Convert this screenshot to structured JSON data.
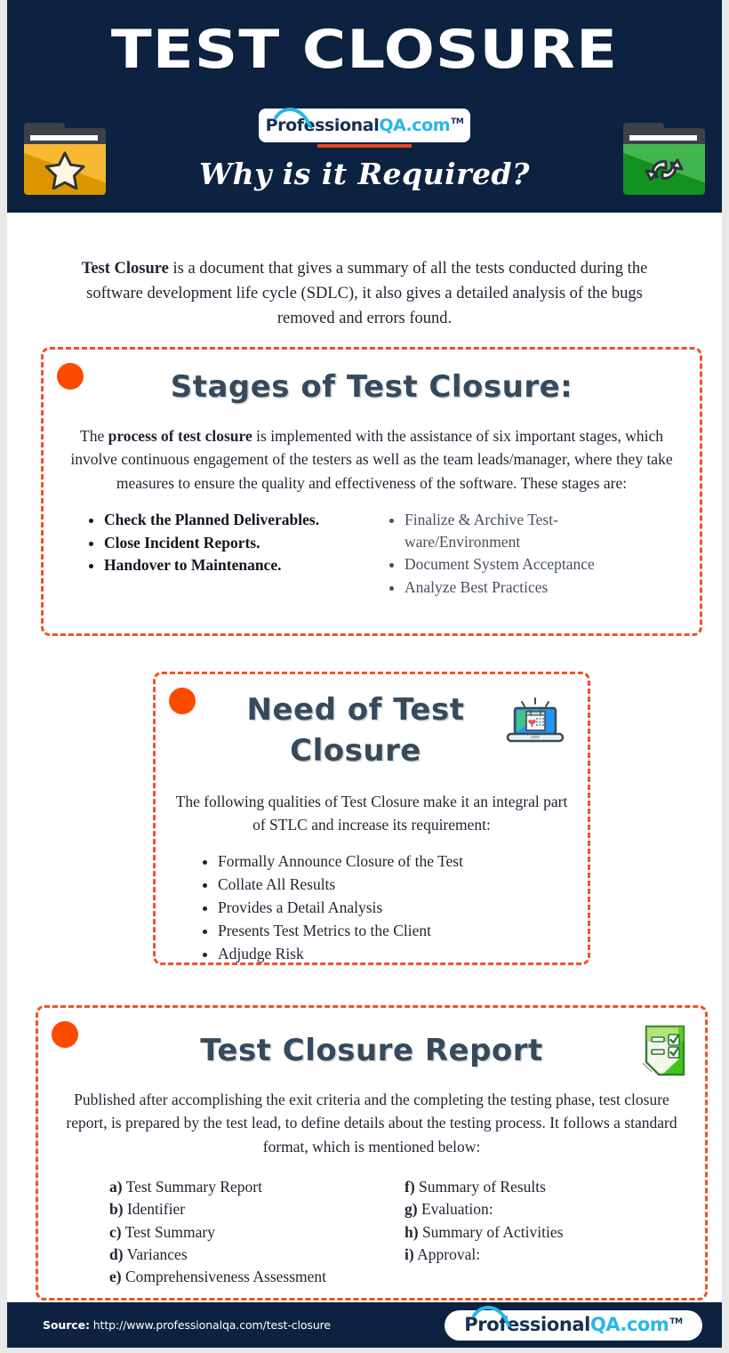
{
  "header": {
    "title": "TEST CLOSURE",
    "subtitle": "Why is it Required?",
    "logo": {
      "part1": "Professional",
      "part2": "QA",
      "part3": ".com",
      "tm": "TM"
    },
    "icons": {
      "left": "star-folder-icon",
      "right": "sync-folder-icon"
    },
    "colors": {
      "background": "#0d2240",
      "logo_dark": "#17304f",
      "logo_cyan": "#29b6e8",
      "logo_underline": "#e8491d"
    }
  },
  "intro": {
    "bold_lead": "Test Closure",
    "rest": " is a document that gives a summary of all the tests conducted during the software development life cycle (SDLC), it also gives a detailed analysis of the bugs removed and errors found."
  },
  "sections": [
    {
      "id": "stages",
      "title": "Stages of Test Closure:",
      "paragraph_parts": [
        {
          "text": "The ",
          "bold": false
        },
        {
          "text": "process of test closure",
          "bold": true
        },
        {
          "text": " is implemented with the assistance of six important stages, which involve continuous engagement of the testers as well as the team leads/manager, where they take measures to ensure the quality and effectiveness of the software. These stages are:",
          "bold": false
        }
      ],
      "list_left": [
        "Check the Planned Deliverables.",
        "Close Incident Reports.",
        "Handover to Maintenance."
      ],
      "list_right": [
        "Finalize & Archive Test-ware/Environment",
        "Document System Acceptance",
        "Analyze Best Practices"
      ]
    },
    {
      "id": "need",
      "title": "Need of Test Closure",
      "paragraph": "The following qualities of Test Closure make it an integral part of STLC and increase its requirement:",
      "icon": "laptop-calendar-icon",
      "list": [
        "Formally Announce Closure of the Test",
        "Collate All Results",
        "Provides a Detail Analysis",
        "Presents Test Metrics to the Client",
        "Adjudge Risk"
      ]
    },
    {
      "id": "report",
      "title": "Test Closure Report",
      "paragraph": "Published after accomplishing the exit criteria and the completing the testing phase, test closure report, is prepared by the test lead, to define details about the testing process.  It follows a standard format, which is mentioned below:",
      "icon": "green-checklist-icon",
      "list_left": [
        {
          "marker": "a)",
          "text": " Test Summary Report"
        },
        {
          "marker": "b)",
          "text": " Identifier"
        },
        {
          "marker": "c)",
          "text": " Test Summary"
        },
        {
          "marker": "d)",
          "text": " Variances"
        },
        {
          "marker": "e)",
          "text": " Comprehensiveness Assessment"
        }
      ],
      "list_right": [
        {
          "marker": "f)",
          "text": " Summary of Results"
        },
        {
          "marker": "g)",
          "text": " Evaluation:"
        },
        {
          "marker": "h)",
          "text": " Summary of Activities"
        },
        {
          "marker": "i)",
          "text": " Approval:"
        }
      ]
    }
  ],
  "footer": {
    "source_label": "Source:",
    "source_url": " http://www.professionalqa.com/test-closure",
    "logo": {
      "part1": "Professional",
      "part2": "QA",
      "part3": ".com",
      "tm": "TM"
    }
  },
  "theme": {
    "accent_orange": "#fb4b00",
    "dash_orange": "#f4511e",
    "heading_navy": "#374a5c",
    "navy": "#0d2240"
  }
}
